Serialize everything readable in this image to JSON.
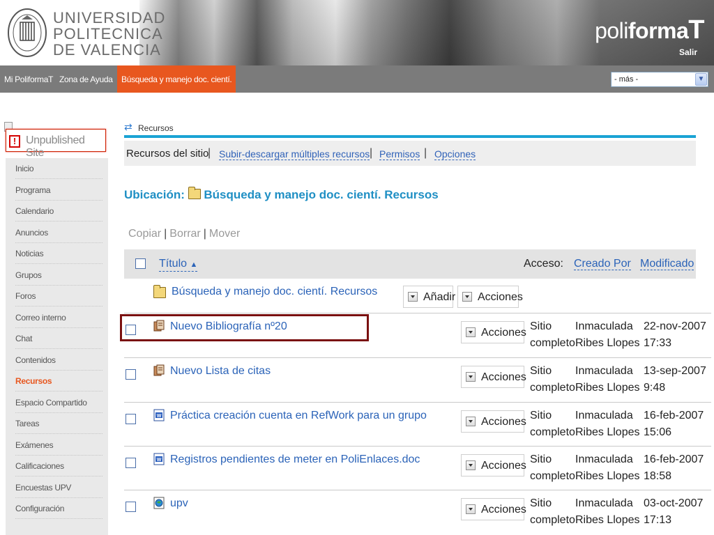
{
  "header": {
    "university_lines": [
      "UNIVERSIDAD",
      "POLITECNICA",
      "DE VALENCIA"
    ],
    "brand_light": "poli",
    "brand_bold": "forma",
    "brand_cap": "T",
    "logout": "Salir"
  },
  "nav": {
    "items": [
      "Mi PoliformaT",
      "Zona de Ayuda",
      "Búsqueda y manejo doc. cientí."
    ],
    "more_select": "- más -"
  },
  "sidebar": {
    "unpublished": "Unpublished Site",
    "items": [
      "Inicio",
      "Programa",
      "Calendario",
      "Anuncios",
      "Noticias",
      "Grupos",
      "Foros",
      "Correo interno",
      "Chat",
      "Contenidos",
      "Recursos",
      "Espacio Compartido",
      "Tareas",
      "Exámenes",
      "Calificaciones",
      "Encuestas UPV",
      "Configuración"
    ],
    "active_item": "Recursos"
  },
  "tool": {
    "title": "Recursos"
  },
  "subnav": {
    "current": "Recursos del sitio",
    "links": [
      "Subir-descargar múltiples recursos",
      "Permisos",
      "Opciones"
    ]
  },
  "location": {
    "label": "Ubicación:",
    "path": "Búsqueda y manejo doc. cientí. Recursos"
  },
  "actions": {
    "copy": "Copiar",
    "delete": "Borrar",
    "move": "Mover"
  },
  "table": {
    "headers": {
      "title": "Título",
      "sort_indicator": "▲",
      "access": "Acceso:",
      "created_by": "Creado Por",
      "modified": "Modificado"
    },
    "folder": {
      "name": "Búsqueda y manejo doc. cientí. Recursos",
      "add_label": "Añadir",
      "actions_label": "Acciones"
    },
    "rows": [
      {
        "name": "Nuevo Bibliografía nº20",
        "icon": "citation-list-icon",
        "actions": "Acciones",
        "access": [
          "Sitio",
          "completo"
        ],
        "creator": [
          "Inmaculada",
          "Ribes Llopes"
        ],
        "modified": [
          "22-nov-2007",
          "17:33"
        ]
      },
      {
        "name": "Nuevo Lista de citas",
        "icon": "citation-list-icon",
        "actions": "Acciones",
        "access": [
          "Sitio",
          "completo"
        ],
        "creator": [
          "Inmaculada",
          "Ribes Llopes"
        ],
        "modified": [
          "13-sep-2007",
          "9:48"
        ]
      },
      {
        "name": "Práctica creación cuenta en RefWork para un grupo",
        "icon": "word-document-icon",
        "actions": "Acciones",
        "access": [
          "Sitio",
          "completo"
        ],
        "creator": [
          "Inmaculada",
          "Ribes Llopes"
        ],
        "modified": [
          "16-feb-2007",
          "15:06"
        ]
      },
      {
        "name": "Registros pendientes de meter en PoliEnlaces.doc",
        "icon": "word-document-icon",
        "actions": "Acciones",
        "access": [
          "Sitio",
          "completo"
        ],
        "creator": [
          "Inmaculada",
          "Ribes Llopes"
        ],
        "modified": [
          "16-feb-2007",
          "18:58"
        ]
      },
      {
        "name": "upv",
        "icon": "web-link-icon",
        "actions": "Acciones",
        "access": [
          "Sitio",
          "completo"
        ],
        "creator": [
          "Inmaculada",
          "Ribes Llopes"
        ],
        "modified": [
          "03-oct-2007",
          "17:13"
        ]
      }
    ]
  },
  "colors": {
    "accent_orange": "#e8571f",
    "link_blue": "#2b63b8",
    "tool_bar_blue": "#1aa3d4",
    "highlight_border": "#7a1010"
  }
}
